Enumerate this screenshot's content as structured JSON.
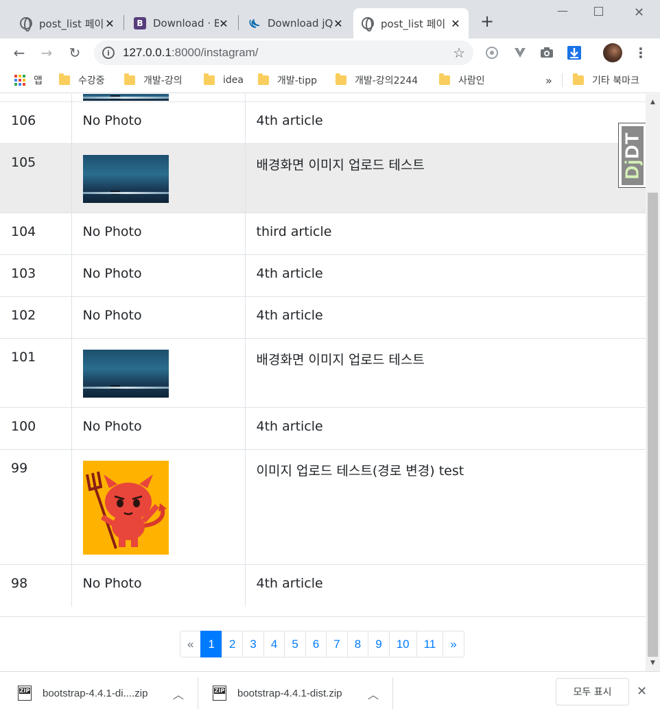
{
  "tabs": [
    {
      "title": "post_list 페이",
      "favicon": "globe-icon"
    },
    {
      "title": "Download · B",
      "favicon": "bootstrap-icon"
    },
    {
      "title": "Download jQ",
      "favicon": "jquery-icon"
    },
    {
      "title": "post_list 페이",
      "favicon": "globe-icon",
      "active": true
    }
  ],
  "toolbar": {
    "url_host": "127.0.0.1",
    "url_rest": ":8000/instagram/"
  },
  "bookmarks": {
    "apps_label": "앱",
    "items": [
      "수강중",
      "개발-강의",
      "idea",
      "개발-tipp",
      "개발-강의2244",
      "사람인"
    ],
    "overflow": "»",
    "other": "기타 북마크"
  },
  "posts": [
    {
      "id": "",
      "photo": "thumb",
      "text": ""
    },
    {
      "id": "106",
      "photo": "No Photo",
      "text": "4th article"
    },
    {
      "id": "105",
      "photo": "thumb",
      "text": "배경화면 이미지 업로드 테스트"
    },
    {
      "id": "104",
      "photo": "No Photo",
      "text": "third article"
    },
    {
      "id": "103",
      "photo": "No Photo",
      "text": "4th article"
    },
    {
      "id": "102",
      "photo": "No Photo",
      "text": "4th article"
    },
    {
      "id": "101",
      "photo": "thumb",
      "text": "배경화면 이미지 업로드 테스트"
    },
    {
      "id": "100",
      "photo": "No Photo",
      "text": "4th article"
    },
    {
      "id": "99",
      "photo": "devil",
      "text": "이미지 업로드 테스트(경로 변경) test"
    },
    {
      "id": "98",
      "photo": "No Photo",
      "text": "4th article"
    }
  ],
  "pagination": {
    "prev": "«",
    "pages": [
      "1",
      "2",
      "3",
      "4",
      "5",
      "6",
      "7",
      "8",
      "9",
      "10",
      "11"
    ],
    "active": "1",
    "next": "»"
  },
  "djdt": {
    "label_dj": "Dj",
    "label_dt": "DT"
  },
  "downloads": {
    "items": [
      "bootstrap-4.4.1-di....zip",
      "bootstrap-4.4.1-dist.zip"
    ],
    "show_all": "모두 표시"
  },
  "colors": {
    "tabstrip": "#dee1e6",
    "highlight_row": "#ececec",
    "primary": "#007bff"
  }
}
